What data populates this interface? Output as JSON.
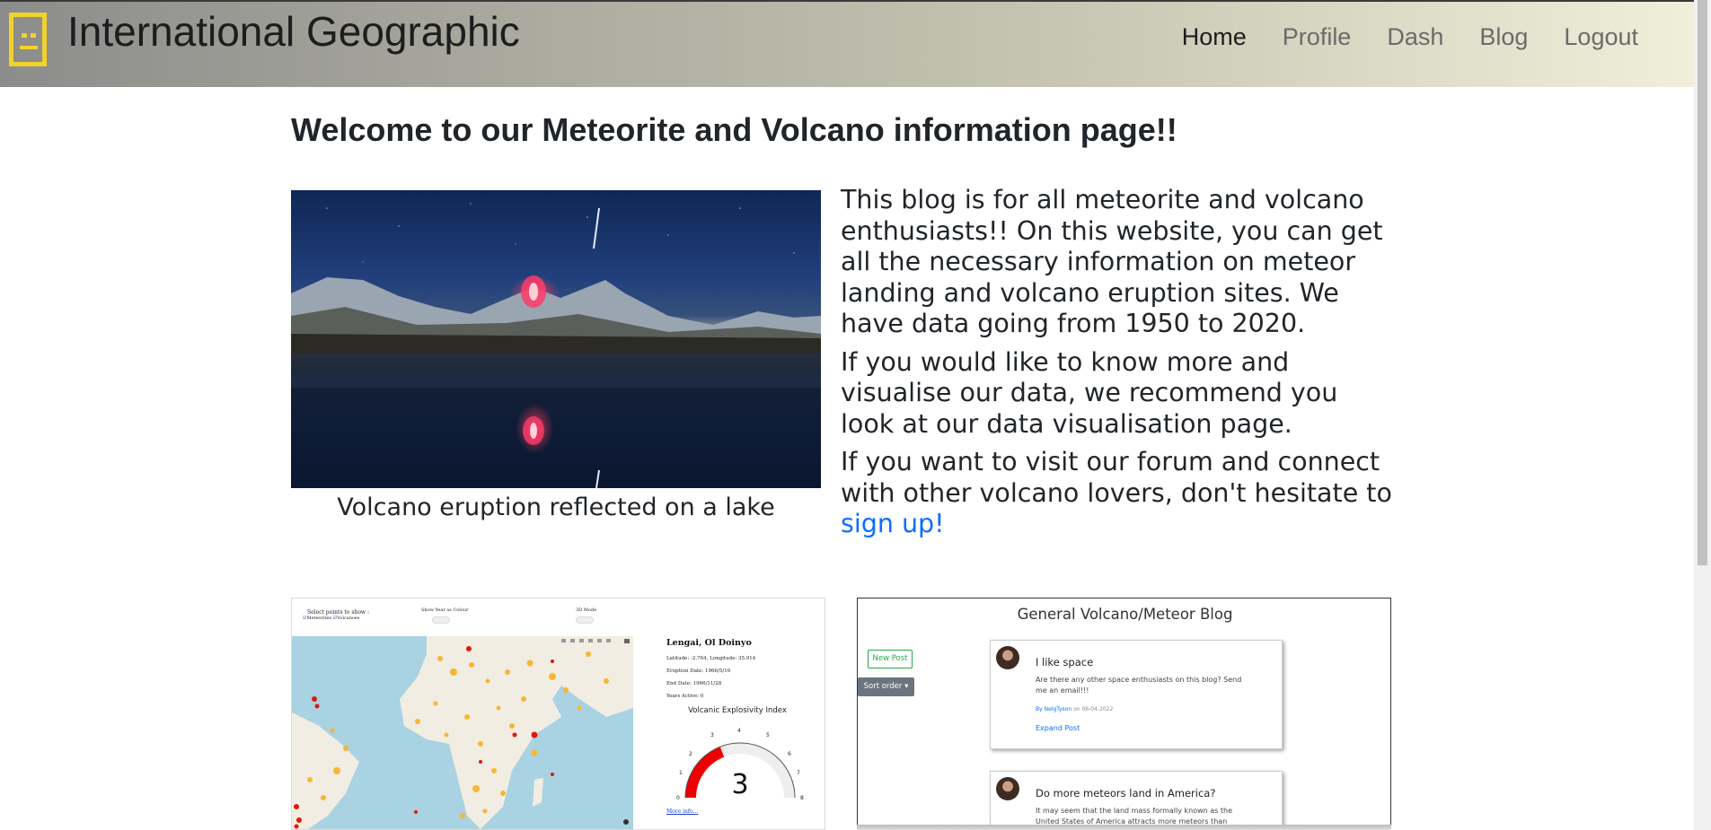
{
  "nav": {
    "brand": "International Geographic",
    "logo_icon": "robot-face-icon",
    "links": [
      "Home",
      "Profile",
      "Dash",
      "Blog",
      "Logout"
    ],
    "active": "Home"
  },
  "main": {
    "heading": "Welcome to our Meteorite and Volcano information page!!",
    "hero_caption": "Volcano eruption reflected on a lake",
    "intro_p1": "This blog is for all meteorite and volcano enthusiasts!! On this website, you can get all the necessary information on meteor landing and volcano eruption sites. We have data going from 1950 to 2020.",
    "intro_p2": "If you would like to know more and visualise our data, we recommend you look at our data visualisation page.",
    "intro_p3_prefix": "If you want to visit our forum and connect with other volcano lovers, don't hesitate to",
    "intro_p3_link": "sign up!"
  },
  "dash_preview": {
    "select_label": "Select points to show :",
    "opt_meteorites": "Meteorites",
    "opt_volcanoes": "Volcanoes",
    "year_colour": "Show Year as Colour",
    "mode_3d": "3D Mode",
    "volcano_name": "Lengai, Ol Doinyo",
    "latlong": "Latitude: -2.764, Longitude: 35.914",
    "eruption_date": "Eruption Date: 1966/5/16",
    "end_date": "End Date: 1966/11/28",
    "years_active": "Years Active: 0",
    "gauge_title": "Volcanic Explosivity Index",
    "gauge_value": "3",
    "gauge_ticks": [
      "0",
      "1",
      "2",
      "3",
      "4",
      "5",
      "6",
      "7",
      "8"
    ],
    "more_info": "More info..."
  },
  "blog_preview": {
    "title": "General Volcano/Meteor Blog",
    "new_post": "New Post",
    "sort_order": "Sort order",
    "posts": [
      {
        "title": "I like space",
        "body": "Are there any other space enthusiasts on this blog? Send me an email!!!",
        "by": "By",
        "author": "NelgTyson",
        "date": "on 06-04-2022",
        "expand": "Expand Post"
      },
      {
        "title": "Do more meteors land in America?",
        "body": "It may seem that the land mass formally known as the United States of America attracts more meteors than other"
      }
    ]
  }
}
